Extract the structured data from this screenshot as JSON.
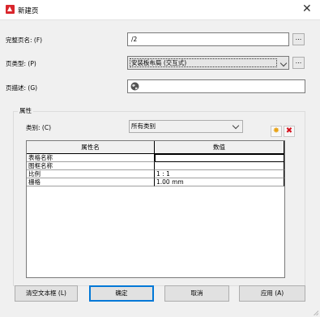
{
  "dialog": {
    "title": "新建页",
    "close_glyph": "✕"
  },
  "form": {
    "full_name_label": "完整页名: (F)",
    "full_name_value": "/2",
    "browse_glyph": "...",
    "page_type_label": "页类型: (P)",
    "page_type_value": "安装板布局 (交互式)",
    "page_desc_label": "页描述: (G)",
    "page_desc_value": ""
  },
  "properties": {
    "group_title": "属性",
    "category_label": "类别: (C)",
    "category_value": "所有类别",
    "add_icon": "star-icon",
    "delete_icon": "delete-icon",
    "columns": [
      "属性名",
      "数值"
    ],
    "rows": [
      {
        "name": "表格名称",
        "value": ""
      },
      {
        "name": "图框名称",
        "value": ""
      },
      {
        "name": "比例",
        "value": "1 : 1"
      },
      {
        "name": "栅格",
        "value": "1.00 mm"
      }
    ]
  },
  "buttons": {
    "clear": "清空文本框 (L)",
    "ok": "确定",
    "cancel": "取消",
    "apply": "应用 (A)"
  }
}
